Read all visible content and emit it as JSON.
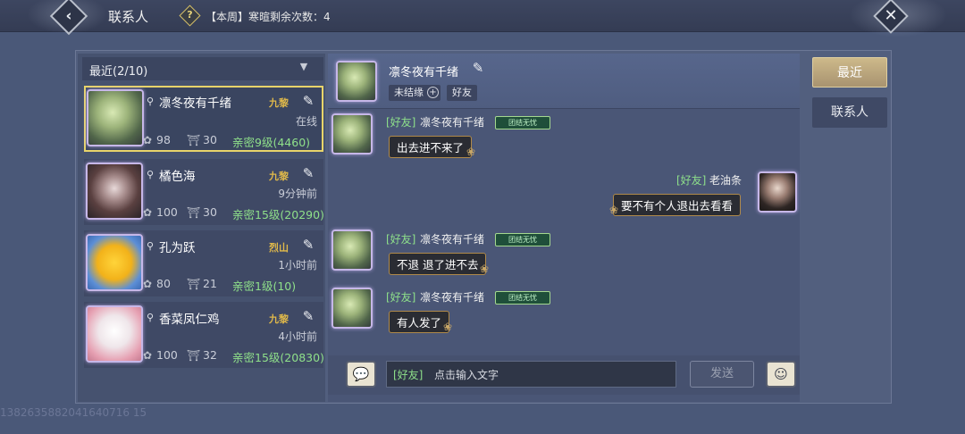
{
  "topbar": {
    "back_icon": "chevron-left-icon",
    "title": "联系人",
    "help_icon": "question-icon",
    "weekly_text": "【本周】寒暄剩余次数：4",
    "close_icon": "close-icon"
  },
  "contact_list": {
    "header": "最近(2/10)",
    "items": [
      {
        "name": "凛冬夜有千绪",
        "server": "九黎",
        "status": "在线",
        "flowers": "98",
        "gifts": "30",
        "intimacy": "亲密9级(4460)",
        "selected": true
      },
      {
        "name": "橘色海",
        "server": "九黎",
        "status": "9分钟前",
        "flowers": "100",
        "gifts": "30",
        "intimacy": "亲密15级(20290)",
        "selected": false
      },
      {
        "name": "孔为跃",
        "server": "烈山",
        "status": "1小时前",
        "flowers": "80",
        "gifts": "21",
        "intimacy": "亲密1级(10)",
        "selected": false
      },
      {
        "name": "香菜凤仁鸡",
        "server": "九黎",
        "status": "4小时前",
        "flowers": "100",
        "gifts": "32",
        "intimacy": "亲密15级(20830)",
        "selected": false
      }
    ]
  },
  "chat": {
    "header_name": "凛冬夜有千绪",
    "tag_unbound": "未结缘",
    "tag_friend": "好友",
    "messages": [
      {
        "prefix": "[好友]",
        "name": "凛冬夜有千绪",
        "badge": "团结无忧",
        "text": "出去进不来了"
      },
      {
        "prefix": "[好友]",
        "name": "老油条",
        "text": "要不有个人退出去看看"
      },
      {
        "prefix": "[好友]",
        "name": "凛冬夜有千绪",
        "badge": "团结无忧",
        "text": "不退 退了进不去"
      },
      {
        "prefix": "[好友]",
        "name": "凛冬夜有千绪",
        "badge": "团结无忧",
        "text": "有人发了"
      }
    ],
    "input_prefix": "[好友]",
    "input_placeholder": "点击输入文字",
    "send_label": "发送"
  },
  "tabs": {
    "recent": "最近",
    "contacts": "联系人"
  },
  "watermark": "1382635882041640716 15"
}
